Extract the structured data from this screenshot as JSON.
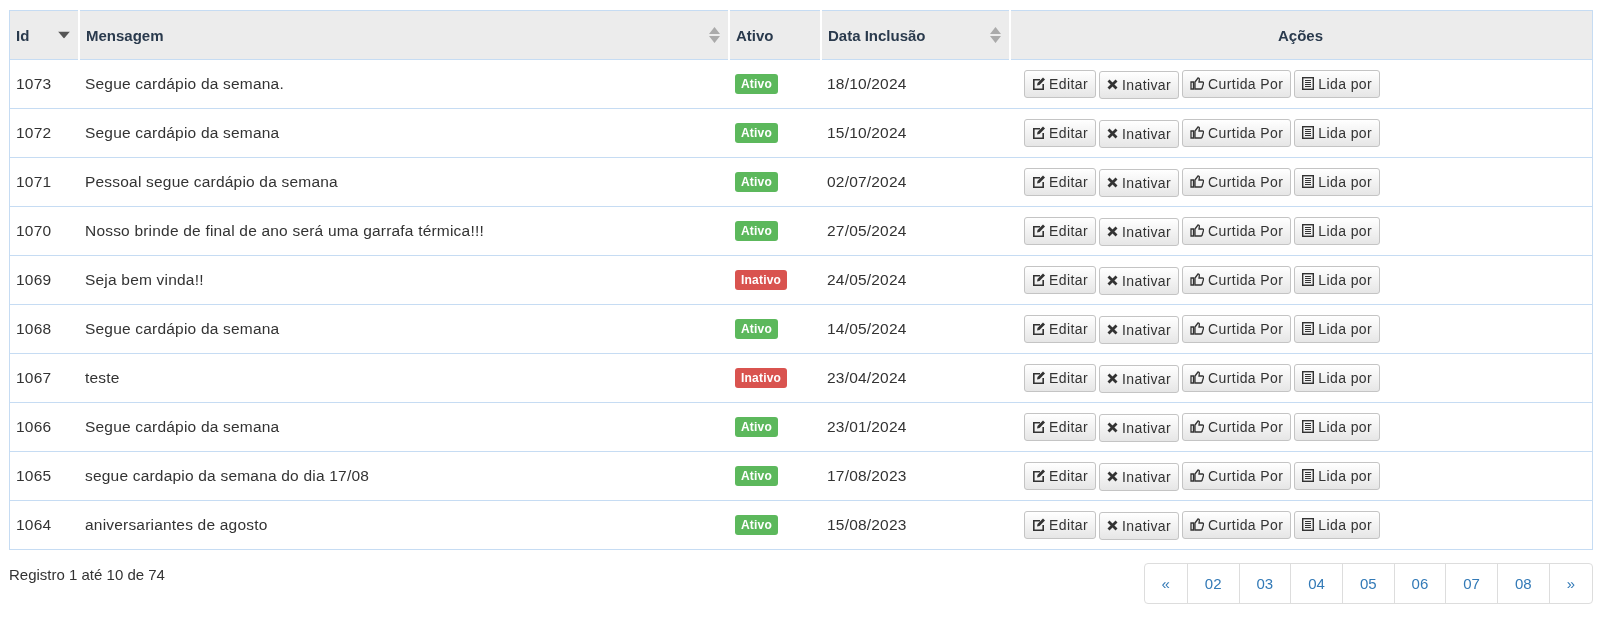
{
  "table": {
    "columns": [
      {
        "label": "Id",
        "sortable": true,
        "sorted": true
      },
      {
        "label": "Mensagem",
        "sortable": true,
        "sorted": false
      },
      {
        "label": "Ativo",
        "sortable": false,
        "sorted": false
      },
      {
        "label": "Data Inclusão",
        "sortable": true,
        "sorted": false
      },
      {
        "label": "Ações",
        "sortable": false,
        "sorted": false
      }
    ],
    "rows": [
      {
        "id": "1073",
        "message": "Segue cardápio da semana.",
        "status": {
          "label": "Ativo",
          "active": true
        },
        "date": "18/10/2024",
        "actions": [
          {
            "kind": "edit",
            "label": "Editar"
          },
          {
            "kind": "deactivate",
            "label": "Inativar"
          },
          {
            "kind": "likes",
            "label": "Curtida Por"
          },
          {
            "kind": "reads",
            "label": "Lida por"
          }
        ]
      },
      {
        "id": "1072",
        "message": "Segue cardápio da semana",
        "status": {
          "label": "Ativo",
          "active": true
        },
        "date": "15/10/2024",
        "actions": [
          {
            "kind": "edit",
            "label": "Editar"
          },
          {
            "kind": "deactivate",
            "label": "Inativar"
          },
          {
            "kind": "likes",
            "label": "Curtida Por"
          },
          {
            "kind": "reads",
            "label": "Lida por"
          }
        ]
      },
      {
        "id": "1071",
        "message": "Pessoal segue cardápio da semana",
        "status": {
          "label": "Ativo",
          "active": true
        },
        "date": "02/07/2024",
        "actions": [
          {
            "kind": "edit",
            "label": "Editar"
          },
          {
            "kind": "deactivate",
            "label": "Inativar"
          },
          {
            "kind": "likes",
            "label": "Curtida Por"
          },
          {
            "kind": "reads",
            "label": "Lida por"
          }
        ]
      },
      {
        "id": "1070",
        "message": "Nosso brinde de final de ano será uma garrafa térmica!!!",
        "status": {
          "label": "Ativo",
          "active": true
        },
        "date": "27/05/2024",
        "actions": [
          {
            "kind": "edit",
            "label": "Editar"
          },
          {
            "kind": "deactivate",
            "label": "Inativar"
          },
          {
            "kind": "likes",
            "label": "Curtida Por"
          },
          {
            "kind": "reads",
            "label": "Lida por"
          }
        ]
      },
      {
        "id": "1069",
        "message": "Seja bem vinda!!",
        "status": {
          "label": "Inativo",
          "active": false
        },
        "date": "24/05/2024",
        "actions": [
          {
            "kind": "edit",
            "label": "Editar"
          },
          {
            "kind": "deactivate",
            "label": "Inativar"
          },
          {
            "kind": "likes",
            "label": "Curtida Por"
          },
          {
            "kind": "reads",
            "label": "Lida por"
          }
        ]
      },
      {
        "id": "1068",
        "message": "Segue cardápio da semana",
        "status": {
          "label": "Ativo",
          "active": true
        },
        "date": "14/05/2024",
        "actions": [
          {
            "kind": "edit",
            "label": "Editar"
          },
          {
            "kind": "deactivate",
            "label": "Inativar"
          },
          {
            "kind": "likes",
            "label": "Curtida Por"
          },
          {
            "kind": "reads",
            "label": "Lida por"
          }
        ]
      },
      {
        "id": "1067",
        "message": "teste",
        "status": {
          "label": "Inativo",
          "active": false
        },
        "date": "23/04/2024",
        "actions": [
          {
            "kind": "edit",
            "label": "Editar"
          },
          {
            "kind": "deactivate",
            "label": "Inativar"
          },
          {
            "kind": "likes",
            "label": "Curtida Por"
          },
          {
            "kind": "reads",
            "label": "Lida por"
          }
        ]
      },
      {
        "id": "1066",
        "message": "Segue cardápio da semana",
        "status": {
          "label": "Ativo",
          "active": true
        },
        "date": "23/01/2024",
        "actions": [
          {
            "kind": "edit",
            "label": "Editar"
          },
          {
            "kind": "deactivate",
            "label": "Inativar"
          },
          {
            "kind": "likes",
            "label": "Curtida Por"
          },
          {
            "kind": "reads",
            "label": "Lida por"
          }
        ]
      },
      {
        "id": "1065",
        "message": "segue cardapio da semana do dia 17/08",
        "status": {
          "label": "Ativo",
          "active": true
        },
        "date": "17/08/2023",
        "actions": [
          {
            "kind": "edit",
            "label": "Editar"
          },
          {
            "kind": "deactivate",
            "label": "Inativar"
          },
          {
            "kind": "likes",
            "label": "Curtida Por"
          },
          {
            "kind": "reads",
            "label": "Lida por"
          }
        ]
      },
      {
        "id": "1064",
        "message": "aniversariantes de agosto",
        "status": {
          "label": "Ativo",
          "active": true
        },
        "date": "15/08/2023",
        "actions": [
          {
            "kind": "edit",
            "label": "Editar"
          },
          {
            "kind": "deactivate",
            "label": "Inativar"
          },
          {
            "kind": "likes",
            "label": "Curtida Por"
          },
          {
            "kind": "reads",
            "label": "Lida por"
          }
        ]
      }
    ]
  },
  "footer": {
    "summary": "Registro 1 até 10 de 74"
  },
  "pagination": [
    "«",
    "02",
    "03",
    "04",
    "05",
    "06",
    "07",
    "08",
    "»"
  ]
}
